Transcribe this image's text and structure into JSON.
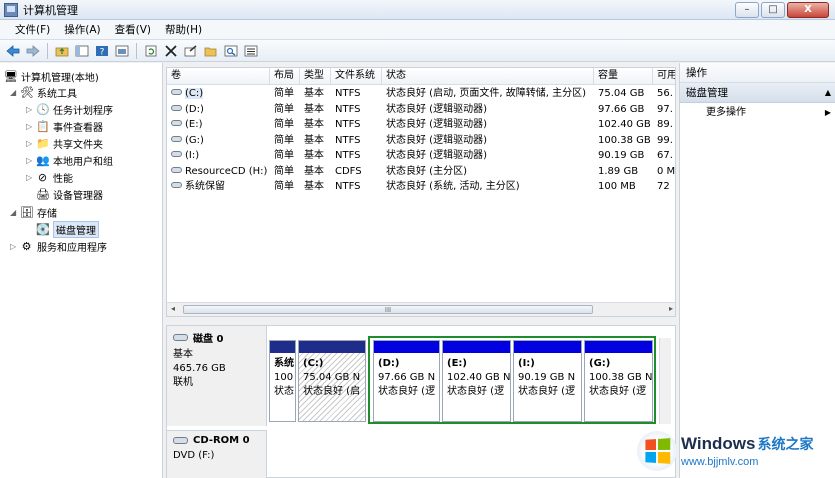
{
  "window": {
    "title": "计算机管理",
    "minimize": "–",
    "maximize": "□",
    "close": "X"
  },
  "menu": [
    "文件(F)",
    "操作(A)",
    "查看(V)",
    "帮助(H)"
  ],
  "toolbar_icons": [
    "back-arrow-icon",
    "forward-arrow-icon",
    "folder-up-icon",
    "console-tree-icon",
    "help-icon",
    "properties-icon",
    "refresh-icon",
    "delete-icon",
    "properties-sheet-icon",
    "open-folder-icon",
    "search-icon",
    "settings-icon"
  ],
  "tree": {
    "items": [
      {
        "label": "计算机管理(本地)",
        "level": 0,
        "expander": "",
        "icon": "computer-icon"
      },
      {
        "label": "系统工具",
        "level": 1,
        "expander": "◢",
        "icon": "tools-icon"
      },
      {
        "label": "任务计划程序",
        "level": 2,
        "expander": "▷",
        "icon": "clock-icon"
      },
      {
        "label": "事件查看器",
        "level": 2,
        "expander": "▷",
        "icon": "event-viewer-icon"
      },
      {
        "label": "共享文件夹",
        "level": 2,
        "expander": "▷",
        "icon": "shared-folder-icon"
      },
      {
        "label": "本地用户和组",
        "level": 2,
        "expander": "▷",
        "icon": "users-icon"
      },
      {
        "label": "性能",
        "level": 2,
        "expander": "▷",
        "icon": "performance-icon"
      },
      {
        "label": "设备管理器",
        "level": 2,
        "expander": "",
        "icon": "device-manager-icon"
      },
      {
        "label": "存储",
        "level": 1,
        "expander": "◢",
        "icon": "storage-icon"
      },
      {
        "label": "磁盘管理",
        "level": 2,
        "expander": "",
        "icon": "disk-management-icon",
        "selected": true
      },
      {
        "label": "服务和应用程序",
        "level": 1,
        "expander": "▷",
        "icon": "services-icon"
      }
    ]
  },
  "volumes": {
    "headers": [
      "卷",
      "布局",
      "类型",
      "文件系统",
      "状态",
      "容量",
      "可用"
    ],
    "rows": [
      [
        "(C:)",
        "简单",
        "基本",
        "NTFS",
        "状态良好 (启动, 页面文件, 故障转储, 主分区)",
        "75.04 GB",
        "56."
      ],
      [
        "(D:)",
        "简单",
        "基本",
        "NTFS",
        "状态良好 (逻辑驱动器)",
        "97.66 GB",
        "97."
      ],
      [
        "(E:)",
        "简单",
        "基本",
        "NTFS",
        "状态良好 (逻辑驱动器)",
        "102.40 GB",
        "89."
      ],
      [
        "(G:)",
        "简单",
        "基本",
        "NTFS",
        "状态良好 (逻辑驱动器)",
        "100.38 GB",
        "99."
      ],
      [
        "(I:)",
        "简单",
        "基本",
        "NTFS",
        "状态良好 (逻辑驱动器)",
        "90.19 GB",
        "67."
      ],
      [
        "ResourceCD (H:)",
        "简单",
        "基本",
        "CDFS",
        "状态良好 (主分区)",
        "1.89 GB",
        "0 M"
      ],
      [
        "系统保留",
        "简单",
        "基本",
        "NTFS",
        "状态良好 (系统, 活动, 主分区)",
        "100 MB",
        "72"
      ]
    ],
    "scroll_grip": "III",
    "scroll_left": "◂",
    "scroll_right": "▸"
  },
  "disks": [
    {
      "name": "磁盘 0",
      "lines": [
        "基本",
        "465.76 GB",
        "联机"
      ],
      "partitions": [
        {
          "name": "系统",
          "size": "100",
          "status": "状态"
        },
        {
          "name": "(C:)",
          "size": "75.04 GB N",
          "status": "状态良好 (启"
        },
        {
          "name": "(D:)",
          "size": "97.66 GB N",
          "status": "状态良好 (逻"
        },
        {
          "name": "(E:)",
          "size": "102.40 GB N",
          "status": "状态良好 (逻"
        },
        {
          "name": "(I:)",
          "size": "90.19 GB N",
          "status": "状态良好 (逻"
        },
        {
          "name": "(G:)",
          "size": "100.38 GB N",
          "status": "状态良好 (逻"
        }
      ]
    },
    {
      "name": "CD-ROM 0",
      "lines": [
        "DVD (F:)"
      ]
    }
  ],
  "actions": {
    "header": "操作",
    "section": "磁盘管理",
    "section_caret": "▲",
    "items": [
      {
        "label": "更多操作",
        "caret": "▶"
      }
    ]
  },
  "watermark": {
    "brand": "Windows",
    "brand_cn": "系统之家",
    "url": "www.bjjmlv.com"
  }
}
